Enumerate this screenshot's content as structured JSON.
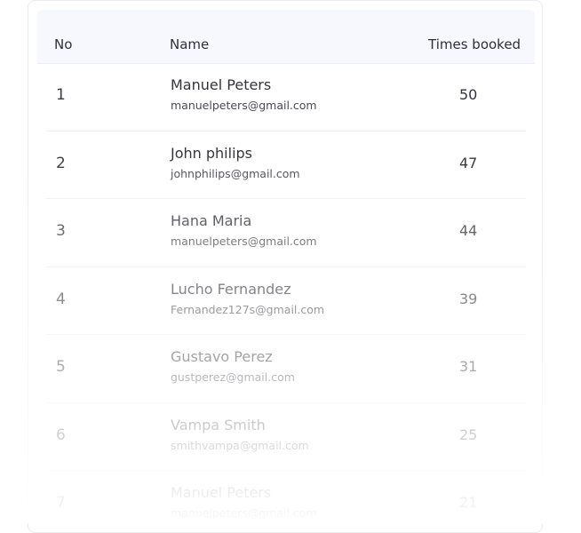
{
  "table": {
    "headers": {
      "no": "No",
      "name": "Name",
      "times": "Times booked"
    },
    "rows": [
      {
        "no": "1",
        "name": "Manuel Peters",
        "email": "manuelpeters@gmail.com",
        "times": "50"
      },
      {
        "no": "2",
        "name": "John philips",
        "email": "johnphilips@gmail.com",
        "times": "47"
      },
      {
        "no": "3",
        "name": "Hana Maria",
        "email": "manuelpeters@gmail.com",
        "times": "44"
      },
      {
        "no": "4",
        "name": "Lucho Fernandez",
        "email": "Fernandez127s@gmail.com",
        "times": "39"
      },
      {
        "no": "5",
        "name": "Gustavo Perez",
        "email": "gustperez@gmail.com",
        "times": "31"
      },
      {
        "no": "6",
        "name": "Vampa Smith",
        "email": "smithvampa@gmail.com",
        "times": "25"
      },
      {
        "no": "7",
        "name": "Manuel Peters",
        "email": "manuelpeters@gmail.com",
        "times": "21"
      }
    ]
  }
}
